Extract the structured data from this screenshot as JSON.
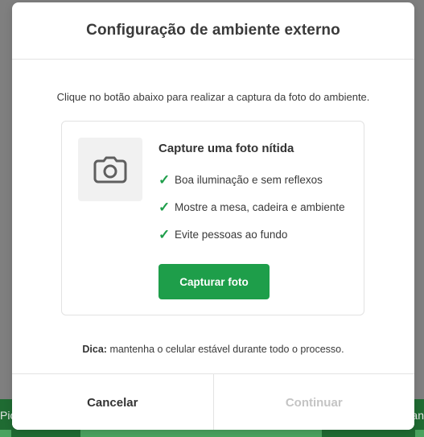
{
  "background": {
    "left_text": "Pic",
    "right_text": "an"
  },
  "modal": {
    "title": "Configuração de ambiente externo",
    "intro": "Clique no botão abaixo para realizar a captura da foto do ambiente.",
    "card": {
      "icon": "camera-icon",
      "title": "Capture uma foto nítida",
      "checks": [
        "Boa iluminação e sem reflexos",
        "Mostre a mesa, cadeira e ambiente",
        "Evite pessoas ao fundo"
      ],
      "check_symbol": "✓",
      "capture_button": "Capturar foto"
    },
    "tip_label": "Dica:",
    "tip_text": " mantenha o celular estável durante todo o processo.",
    "footer": {
      "cancel": "Cancelar",
      "continue": "Continuar"
    }
  },
  "colors": {
    "accent": "#1e9e4a",
    "disabled_text": "#c4c4c4"
  }
}
